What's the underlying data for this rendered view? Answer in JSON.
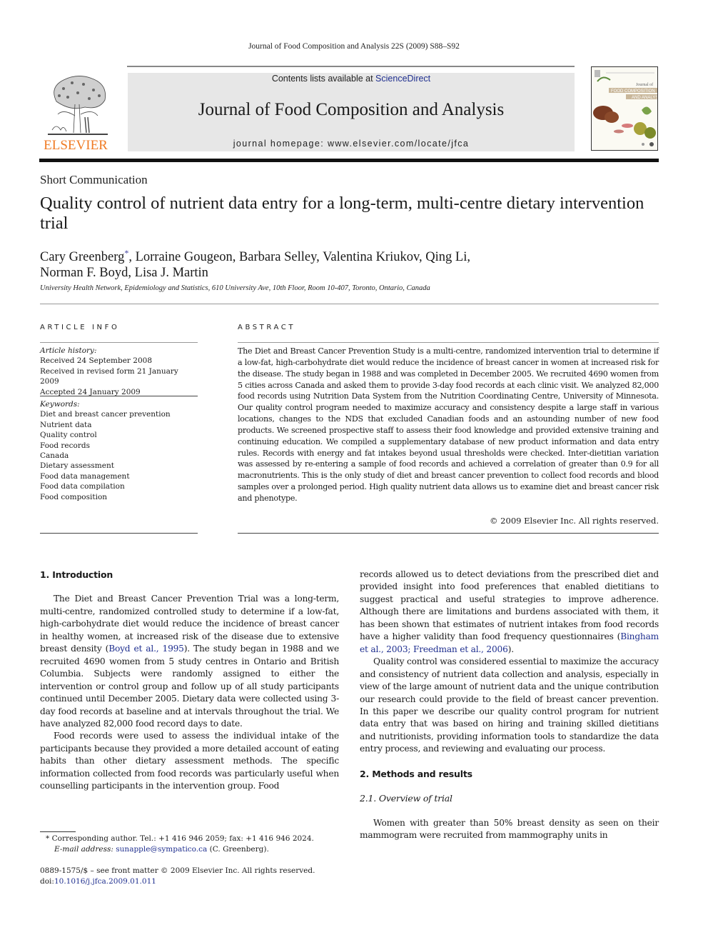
{
  "running_head": "Journal of Food Composition and Analysis 22S (2009) S88–S92",
  "header": {
    "publisher_logo_text": "ELSEVIER",
    "contents_prefix": "Contents lists available at ",
    "contents_link": "ScienceDirect",
    "journal_title": "Journal of Food Composition and Analysis",
    "homepage": "journal homepage: www.elsevier.com/locate/jfca",
    "cover_lines": [
      "Journal of",
      "FOOD COMPOSITION",
      "AND ANALYSIS"
    ]
  },
  "article": {
    "type": "Short Communication",
    "title": "Quality control of nutrient data entry for a long-term, multi-centre dietary intervention trial",
    "authors_line1_first": "Cary Greenberg",
    "authors_marker": "*",
    "authors_line1_rest": ", Lorraine Gougeon, Barbara Selley, Valentina Kriukov, Qing Li,",
    "authors_line2": "Norman F. Boyd, Lisa J. Martin",
    "affiliation": "University Health Network, Epidemiology and Statistics, 610 University Ave, 10th Floor, Room 10-407, Toronto, Ontario, Canada"
  },
  "article_info": {
    "heading": "ARTICLE INFO",
    "history_label": "Article history:",
    "history": [
      "Received 24 September 2008",
      "Received in revised form 21 January 2009",
      "Accepted 24 January 2009"
    ],
    "keywords_label": "Keywords:",
    "keywords": [
      "Diet and breast cancer prevention",
      "Nutrient data",
      "Quality control",
      "Food records",
      "Canada",
      "Dietary assessment",
      "Food data management",
      "Food data compilation",
      "Food composition"
    ]
  },
  "abstract": {
    "heading": "ABSTRACT",
    "text": "The Diet and Breast Cancer Prevention Study is a multi-centre, randomized intervention trial to determine if a low-fat, high-carbohydrate diet would reduce the incidence of breast cancer in women at increased risk for the disease. The study began in 1988 and was completed in December 2005. We recruited 4690 women from 5 cities across Canada and asked them to provide 3-day food records at each clinic visit. We analyzed 82,000 food records using Nutrition Data System from the Nutrition Coordinating Centre, University of Minnesota. Our quality control program needed to maximize accuracy and consistency despite a large staff in various locations, changes to the NDS that excluded Canadian foods and an astounding number of new food products. We screened prospective staff to assess their food knowledge and provided extensive training and continuing education. We compiled a supplementary database of new product information and data entry rules. Records with energy and fat intakes beyond usual thresholds were checked. Inter-dietitian variation was assessed by re-entering a sample of food records and achieved a correlation of greater than 0.9 for all macronutrients. This is the only study of diet and breast cancer prevention to collect food records and blood samples over a prolonged period. High quality nutrient data allows us to examine diet and breast cancer risk and phenotype.",
    "copyright": "© 2009 Elsevier Inc. All rights reserved."
  },
  "body": {
    "intro_heading": "1.  Introduction",
    "intro_p1_a": "The Diet and Breast Cancer Prevention Trial was a long-term, multi-centre, randomized controlled study to determine if a low-fat, high-carbohydrate diet would reduce the incidence of breast cancer in healthy women, at increased risk of the disease due to extensive breast density (",
    "intro_p1_cite": "Boyd et al., 1995",
    "intro_p1_b": "). The study began in 1988 and we recruited 4690 women from 5 study centres in Ontario and British Columbia. Subjects were randomly assigned to either the intervention or control group and follow up of all study participants continued until December 2005. Dietary data were collected using 3-day food records at baseline and at intervals throughout the trial. We have analyzed 82,000 food record days to date.",
    "intro_p2": "Food records were used to assess the individual intake of the participants because they provided a more detailed account of eating habits than other dietary assessment methods. The specific information collected from food records was particularly useful when counselling participants in the intervention group. Food",
    "right_p1_a": "records allowed us to detect deviations from the prescribed diet and provided insight into food preferences that enabled dietitians to suggest practical and useful strategies to improve adherence. Although there are limitations and burdens associated with them, it has been shown that estimates of nutrient intakes from food records have a higher validity than food frequency questionnaires (",
    "right_p1_cite1": "Bingham et al., 2003",
    "right_p1_sep": "; ",
    "right_p1_cite2": "Freedman et al., 2006",
    "right_p1_b": ").",
    "right_p2": "Quality control was considered essential to maximize the accuracy and consistency of nutrient data collection and analysis, especially in view of the large amount of nutrient data and the unique contribution our research could provide to the field of breast cancer prevention. In this paper we describe our quality control program for nutrient data entry that was based on hiring and training skilled dietitians and nutritionists, providing information tools to standardize the data entry process, and reviewing and evaluating our process.",
    "methods_heading": "2.  Methods and results",
    "sub_heading": "2.1.  Overview of trial",
    "right_p3": "Women with greater than 50% breast density as seen on their mammogram were recruited from mammography units in"
  },
  "footnotes": {
    "marker": "*",
    "corresponding": " Corresponding author. Tel.: +1 416 946 2059; fax: +1 416 946 2024.",
    "email_label": "E-mail address: ",
    "email": "sunapple@sympatico.ca",
    "email_suffix": " (C. Greenberg).",
    "front_matter": "0889-1575/$ – see front matter © 2009 Elsevier Inc. All rights reserved.",
    "doi_prefix": "doi:",
    "doi": "10.1016/j.jfca.2009.01.011"
  }
}
